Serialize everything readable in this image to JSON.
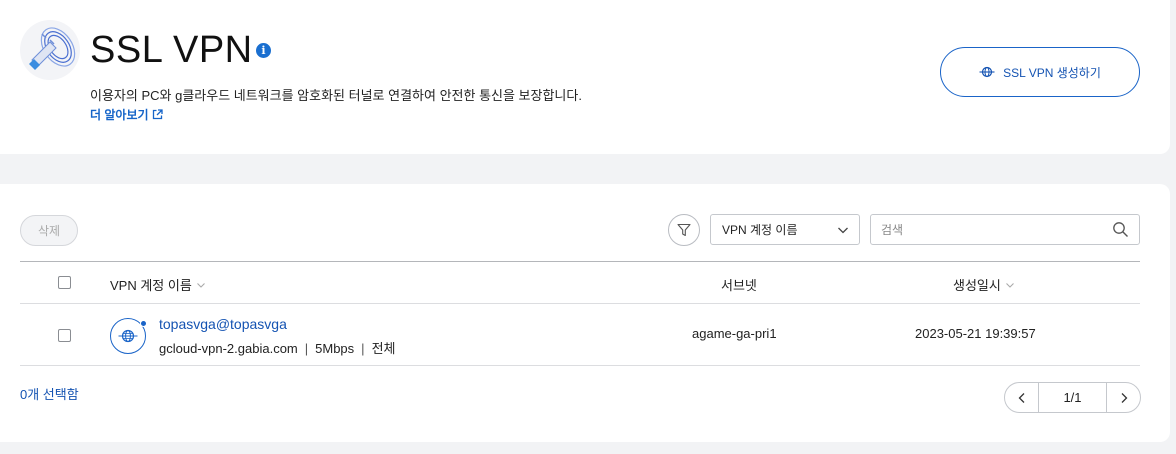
{
  "header": {
    "title": "SSL VPN",
    "info_glyph": "i",
    "description": "이용자의 PC와 g클라우드 네트워크를 암호화된 터널로 연결하여 안전한 통신을 보장합니다.",
    "learn_more": "더 알아보기",
    "create_button": "SSL VPN 생성하기"
  },
  "toolbar": {
    "delete_button": "삭제",
    "filter_select": "VPN 계정 이름",
    "search_placeholder": "검색"
  },
  "table": {
    "columns": {
      "name": "VPN 계정 이름",
      "subnet": "서브넷",
      "created": "생성일시"
    },
    "rows": [
      {
        "account": "topasvga@topasvga",
        "server": "gcloud-vpn-2.gabia.com",
        "bandwidth": "5Mbps",
        "scope": "전체",
        "subnet": "agame-ga-pri1",
        "created": "2023-05-21 19:39:57"
      }
    ]
  },
  "footer": {
    "selected_count": "0개 선택함",
    "page": "1/1"
  },
  "colors": {
    "accent": "#1a64c8",
    "link": "#1453b2",
    "background": "#f2f3f5"
  },
  "icons": [
    "vpn-plug-icon",
    "info-icon",
    "external-link-icon",
    "globe-icon",
    "filter-icon",
    "chevron-down-icon",
    "search-icon",
    "chevron-left-icon",
    "chevron-right-icon"
  ]
}
